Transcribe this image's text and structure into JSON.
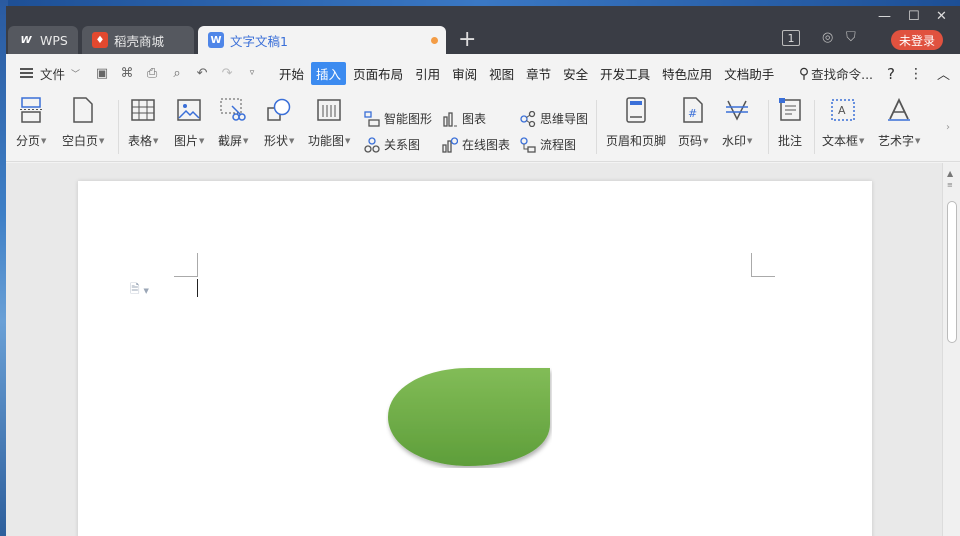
{
  "tabs": [
    {
      "label": "WPS"
    },
    {
      "label": "稻壳商城"
    },
    {
      "label": "文字文稿1"
    }
  ],
  "titlebar": {
    "window_count": "1",
    "login_label": "未登录"
  },
  "menubar": {
    "file_label": "文件",
    "items": [
      "开始",
      "插入",
      "页面布局",
      "引用",
      "审阅",
      "视图",
      "章节",
      "安全",
      "开发工具",
      "特色应用",
      "文档助手"
    ],
    "active_item": "插入",
    "search_label": "查找命令..."
  },
  "ribbon": {
    "page_break": "分页",
    "blank_page": "空白页",
    "table": "表格",
    "picture": "图片",
    "screenshot": "截屏",
    "shape": "形状",
    "function_chart": "功能图",
    "smart_art": "智能图形",
    "chart": "图表",
    "relation_chart": "关系图",
    "online_chart": "在线图表",
    "mind_map": "思维导图",
    "flowchart": "流程图",
    "header_footer": "页眉和页脚",
    "page_number": "页码",
    "watermark": "水印",
    "comment": "批注",
    "text_box": "文本框",
    "word_art": "艺术字"
  },
  "colors": {
    "accent": "#3c8bf0",
    "titlebar": "#3a3d45",
    "login": "#e0523f",
    "shape_fill": "#6fb04a"
  }
}
